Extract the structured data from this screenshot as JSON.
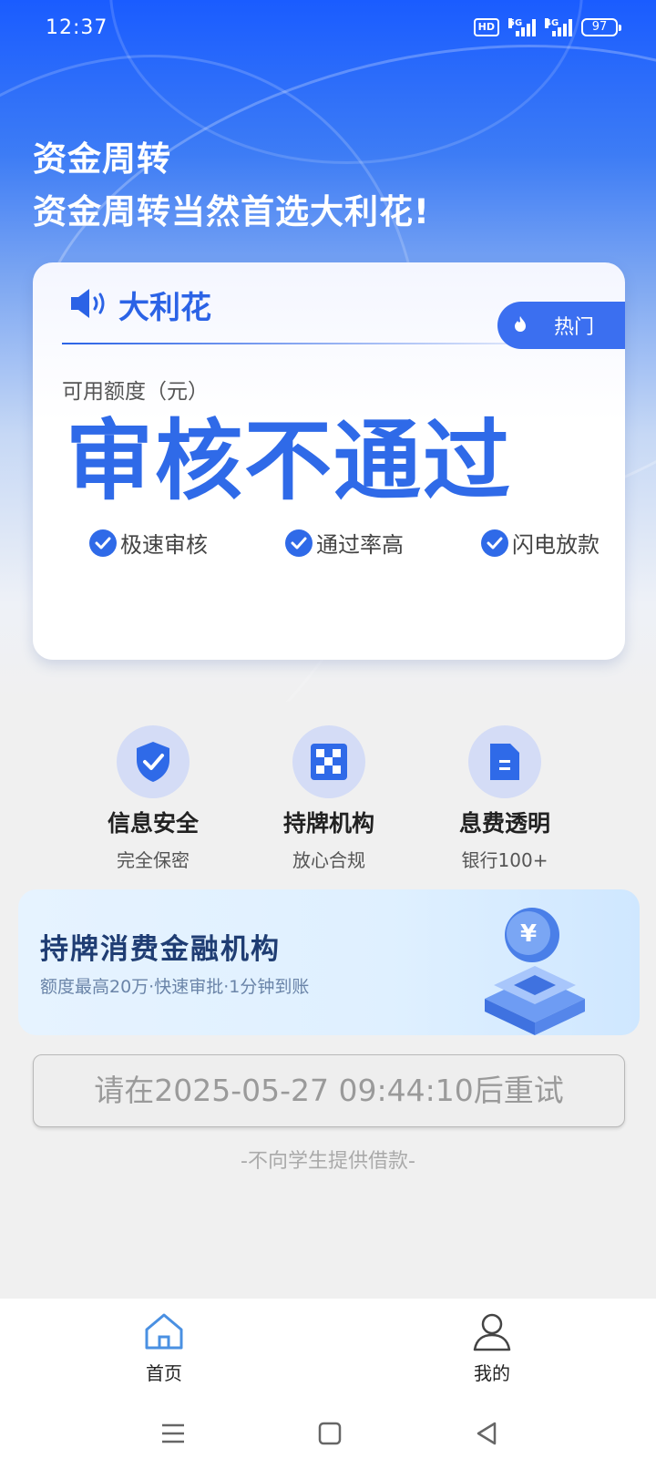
{
  "status_bar": {
    "time": "12:37",
    "hd": "HD",
    "net1": "5G",
    "net2": "4G",
    "battery": "97"
  },
  "header": {
    "line1": "资金周转",
    "line2": "资金周转当然首选大利花!"
  },
  "card": {
    "brand": "大利花",
    "hot_label": "热门",
    "quota_label": "可用额度（元）",
    "status": "审核不通过",
    "features": [
      "极速审核",
      "通过率高",
      "闪电放款"
    ]
  },
  "trust": [
    {
      "title": "信息安全",
      "sub": "完全保密",
      "icon": "shield-icon"
    },
    {
      "title": "持牌机构",
      "sub": "放心合规",
      "icon": "checkerboard-icon"
    },
    {
      "title": "息费透明",
      "sub": "银行100+",
      "icon": "document-icon"
    }
  ],
  "banner": {
    "title": "持牌消费金融机构",
    "subtitle": "额度最高20万·快速审批·1分钟到账",
    "coin_symbol": "¥"
  },
  "retry_button": "请在2025-05-27 09:44:10后重试",
  "disclaimer": "-不向学生提供借款-",
  "tabs": [
    {
      "label": "首页",
      "icon": "home-icon",
      "active": true
    },
    {
      "label": "我的",
      "icon": "user-icon",
      "active": false
    }
  ],
  "colors": {
    "brand_blue": "#2f6ae8",
    "hot_tag": "#3b6ff0",
    "hero_top": "#1a5cff"
  }
}
